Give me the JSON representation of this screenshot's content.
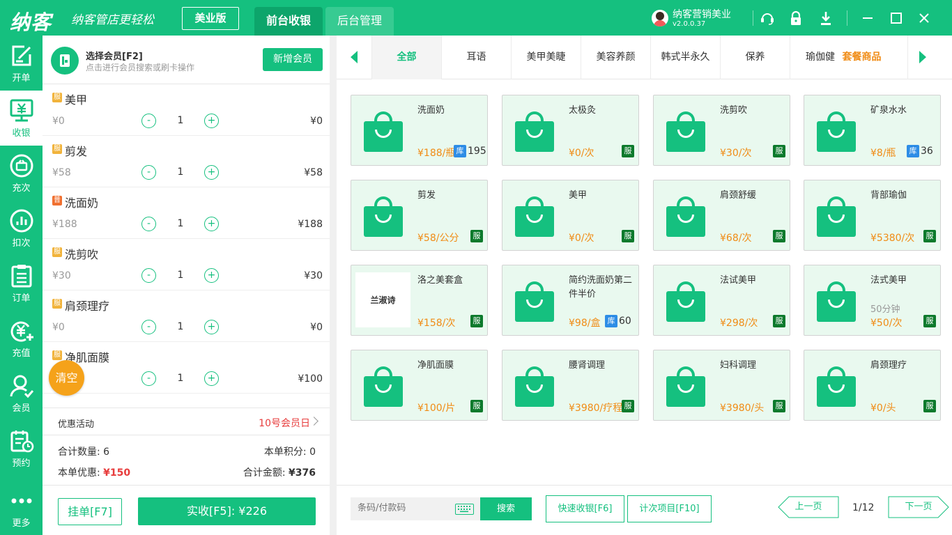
{
  "app": {
    "logo": "纳客",
    "slogan": "纳客管店更轻松",
    "edition": "美业版",
    "tabs": [
      "前台收银",
      "后台管理"
    ],
    "user": {
      "name": "纳客营销美业",
      "version": "v2.0.0.37"
    }
  },
  "sidebar": [
    {
      "label": "开单",
      "icon": "edit-icon"
    },
    {
      "label": "收银",
      "icon": "cash-register-icon",
      "active": true
    },
    {
      "label": "充次",
      "icon": "recharge-times-icon"
    },
    {
      "label": "扣次",
      "icon": "deduct-times-icon"
    },
    {
      "label": "订单",
      "icon": "order-icon"
    },
    {
      "label": "充值",
      "icon": "recharge-icon"
    },
    {
      "label": "会员",
      "icon": "member-icon"
    },
    {
      "label": "预约",
      "icon": "appointment-icon"
    },
    {
      "label": "更多",
      "icon": "more-icon"
    }
  ],
  "member": {
    "title": "选择会员[F2]",
    "subtitle": "点击进行会员搜索或刷卡操作",
    "add_button": "新增会员"
  },
  "cart": {
    "items": [
      {
        "tag": "服",
        "name": "美甲",
        "price": "¥0",
        "qty": "1",
        "total": "¥0"
      },
      {
        "tag": "服",
        "name": "剪发",
        "price": "¥58",
        "qty": "1",
        "total": "¥58"
      },
      {
        "tag": "普",
        "name": "洗面奶",
        "price": "¥188",
        "qty": "1",
        "total": "¥188"
      },
      {
        "tag": "服",
        "name": "洗剪吹",
        "price": "¥30",
        "qty": "1",
        "total": "¥30"
      },
      {
        "tag": "服",
        "name": "肩颈理疗",
        "price": "¥0",
        "qty": "1",
        "total": "¥0"
      },
      {
        "tag": "服",
        "name": "净肌面膜",
        "price": "",
        "qty": "1",
        "total": "¥100"
      }
    ],
    "minus": "-",
    "plus": "+",
    "clear": "清空"
  },
  "promo": {
    "label": "优惠活动",
    "value": "10号会员日"
  },
  "summary": {
    "count_label": "合计数量:",
    "count": "6",
    "points_label": "本单积分:",
    "points": "0",
    "discount_label": "本单优惠:",
    "discount": "¥150",
    "total_label": "合计金额:",
    "total": "¥376"
  },
  "actions": {
    "hold": "挂单[F7]",
    "pay": "实收[F5]: ¥226"
  },
  "categories": [
    "全部",
    "耳语",
    "美甲美睫",
    "美容养颜",
    "韩式半永久",
    "保养",
    "瑜伽健",
    "套餐商品"
  ],
  "products": [
    {
      "name": "洗面奶",
      "price": "¥188/瓶",
      "tag": "库",
      "stock": "195"
    },
    {
      "name": "太极灸",
      "price": "¥0/次",
      "tag": "服"
    },
    {
      "name": "洗剪吹",
      "price": "¥30/次",
      "tag": "服"
    },
    {
      "name": "矿泉水水",
      "price": "¥8/瓶",
      "tag": "库",
      "stock": "36"
    },
    {
      "name": "剪发",
      "price": "¥58/公分",
      "tag": "服"
    },
    {
      "name": "美甲",
      "price": "¥0/次",
      "tag": "服"
    },
    {
      "name": "肩颈舒缓",
      "price": "¥68/次",
      "tag": "服"
    },
    {
      "name": "背部瑜伽",
      "price": "¥5380/次",
      "tag": "服"
    },
    {
      "name": "洛之美套盒",
      "price": "¥158/次",
      "tag": "服",
      "image_text": "兰淑诗"
    },
    {
      "name": "简约洗面奶第二件半价",
      "price": "¥98/盒",
      "tag": "库",
      "stock": "60"
    },
    {
      "name": "法试美甲",
      "price": "¥298/次",
      "tag": "服"
    },
    {
      "name": "法式美甲",
      "price": "¥50/次",
      "tag": "服",
      "sub": "50分钟"
    },
    {
      "name": "净肌面膜",
      "price": "¥100/片",
      "tag": "服"
    },
    {
      "name": "腰肾调理",
      "price": "¥3980/疗程",
      "tag": "服"
    },
    {
      "name": "妇科调理",
      "price": "¥3980/头",
      "tag": "服"
    },
    {
      "name": "肩颈理疗",
      "price": "¥0/头",
      "tag": "服"
    }
  ],
  "bottom": {
    "scan_placeholder": "条码/付款码",
    "search": "搜索",
    "quick_pay": "快速收银[F6]",
    "count_item": "计次项目[F10]",
    "prev": "上一页",
    "page": "1/12",
    "next": "下一页"
  },
  "colors": {
    "primary": "#15c07f",
    "accent_orange": "#f08c16",
    "red": "#e73c3c"
  }
}
